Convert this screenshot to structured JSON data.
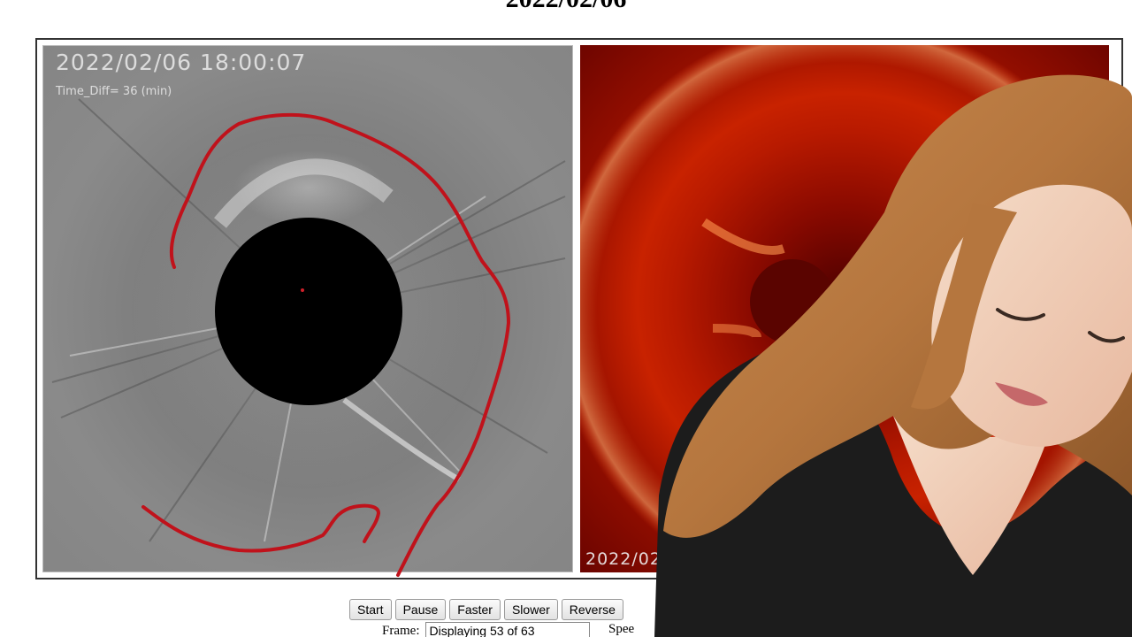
{
  "header": {
    "date_title": "2022/02/06"
  },
  "left_panel": {
    "timestamp": "2022/02/06  18:00:07",
    "time_diff": "Time_Diff= 36 (min)"
  },
  "right_panel": {
    "timestamp": "2022/02"
  },
  "controls": {
    "start_label": "Start",
    "pause_label": "Pause",
    "faster_label": "Faster",
    "slower_label": "Slower",
    "reverse_label": "Reverse"
  },
  "frame_status": {
    "label": "Frame:",
    "value": "Displaying 53 of 63",
    "speed_label": "Spee"
  },
  "colors": {
    "annotation": "#c0121b",
    "occulter": "#000000",
    "corona_red": "#c82200"
  }
}
